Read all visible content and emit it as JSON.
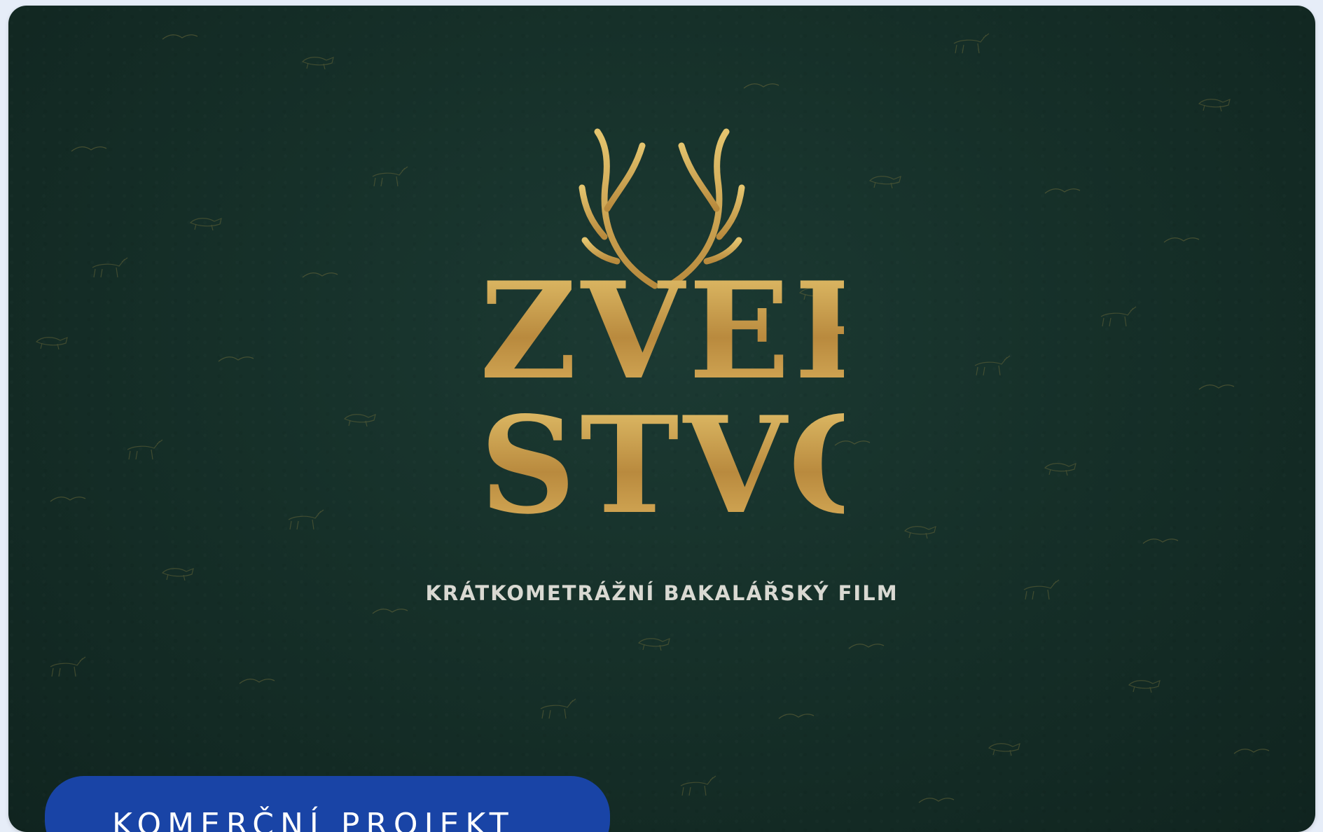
{
  "hero": {
    "logo_line1": "ZVER",
    "logo_line2": "STVO",
    "subtitle": "KRÁTKOMETRÁŽNÍ BAKALÁŘSKÝ FILM"
  },
  "badge": {
    "label": "KOMERČNÍ PROJEKT"
  },
  "colors": {
    "page_background": "#e6edf8",
    "card_background": "#163029",
    "logo_gold": "#c49a47",
    "subtitle": "#d9d9d2",
    "badge_background": "#1944a6",
    "badge_text": "#ffffff"
  },
  "icons": {
    "antlers": "antlers-icon"
  }
}
